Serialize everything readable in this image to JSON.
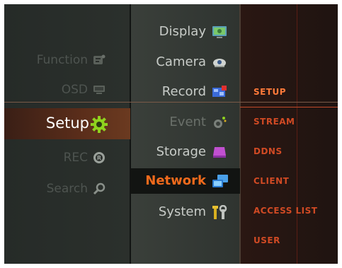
{
  "main_menu": {
    "items": [
      {
        "label": "Function",
        "icon": "function-icon"
      },
      {
        "label": "OSD",
        "icon": "monitor-icon"
      },
      {
        "label": "Setup",
        "icon": "gear-icon",
        "selected": true
      },
      {
        "label": "REC",
        "icon": "record-icon"
      },
      {
        "label": "Search",
        "icon": "magnifier-icon"
      }
    ]
  },
  "setup_menu": {
    "items": [
      {
        "label": "Display",
        "icon": "display-icon"
      },
      {
        "label": "Camera",
        "icon": "camera-icon"
      },
      {
        "label": "Record",
        "icon": "record-film-icon"
      },
      {
        "label": "Event",
        "icon": "event-icon"
      },
      {
        "label": "Storage",
        "icon": "storage-icon"
      },
      {
        "label": "Network",
        "icon": "network-icon",
        "selected": true
      },
      {
        "label": "System",
        "icon": "tools-icon"
      }
    ]
  },
  "network_menu": {
    "items": [
      {
        "label": "SETUP",
        "selected": true
      },
      {
        "label": "STREAM"
      },
      {
        "label": "DDNS"
      },
      {
        "label": "CLIENT"
      },
      {
        "label": "ACCESS LIST"
      },
      {
        "label": "USER"
      }
    ]
  },
  "colors": {
    "accent": "#f06a1c",
    "submenu_text": "#d04a24",
    "selected_row": "#5a2d1a"
  }
}
